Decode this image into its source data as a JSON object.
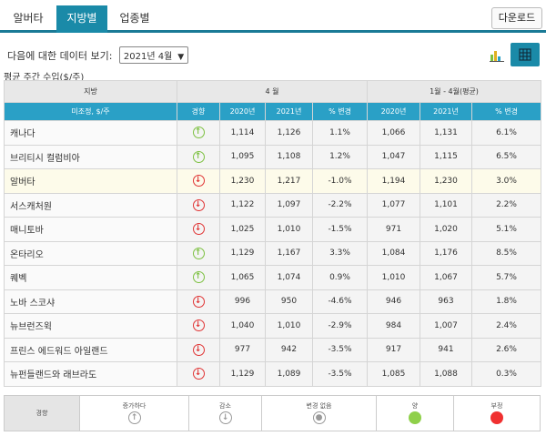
{
  "tabs": [
    {
      "label": "알버타"
    },
    {
      "label": "지방별"
    },
    {
      "label": "업종별"
    }
  ],
  "download_label": "다운로드",
  "controls": {
    "view_label": "다음에 대한 데이터 보기:",
    "selected_month": "2021년 4월"
  },
  "unit_title": "평균 주간 수입($/주)",
  "table": {
    "header_top": {
      "region": "지방",
      "group_month": "4 월",
      "group_ytd": "1월 - 4월(평균)"
    },
    "header_cols": [
      "미조정, $/주",
      "경향",
      "2020년",
      "2021년",
      "% 변경",
      "2020년",
      "2021년",
      "% 변경"
    ],
    "rows": [
      {
        "name": "캐나다",
        "trend": "up",
        "m2020": "1,114",
        "m2021": "1,126",
        "mchg": "1.1%",
        "y2020": "1,066",
        "y2021": "1,131",
        "ychg": "6.1%"
      },
      {
        "name": "브리티시 컬럼비아",
        "trend": "up",
        "m2020": "1,095",
        "m2021": "1,108",
        "mchg": "1.2%",
        "y2020": "1,047",
        "y2021": "1,115",
        "ychg": "6.5%"
      },
      {
        "name": "알버타",
        "trend": "down",
        "m2020": "1,230",
        "m2021": "1,217",
        "mchg": "-1.0%",
        "y2020": "1,194",
        "y2021": "1,230",
        "ychg": "3.0%"
      },
      {
        "name": "서스캐처원",
        "trend": "down",
        "m2020": "1,122",
        "m2021": "1,097",
        "mchg": "-2.2%",
        "y2020": "1,077",
        "y2021": "1,101",
        "ychg": "2.2%"
      },
      {
        "name": "매니토바",
        "trend": "down",
        "m2020": "1,025",
        "m2021": "1,010",
        "mchg": "-1.5%",
        "y2020": "971",
        "y2021": "1,020",
        "ychg": "5.1%"
      },
      {
        "name": "온타리오",
        "trend": "up",
        "m2020": "1,129",
        "m2021": "1,167",
        "mchg": "3.3%",
        "y2020": "1,084",
        "y2021": "1,176",
        "ychg": "8.5%"
      },
      {
        "name": "퀘벡",
        "trend": "up",
        "m2020": "1,065",
        "m2021": "1,074",
        "mchg": "0.9%",
        "y2020": "1,010",
        "y2021": "1,067",
        "ychg": "5.7%"
      },
      {
        "name": "노바 스코샤",
        "trend": "down",
        "m2020": "996",
        "m2021": "950",
        "mchg": "-4.6%",
        "y2020": "946",
        "y2021": "963",
        "ychg": "1.8%"
      },
      {
        "name": "뉴브런즈윅",
        "trend": "down",
        "m2020": "1,040",
        "m2021": "1,010",
        "mchg": "-2.9%",
        "y2020": "984",
        "y2021": "1,007",
        "ychg": "2.4%"
      },
      {
        "name": "프린스 에드워드 아일랜드",
        "trend": "down",
        "m2020": "977",
        "m2021": "942",
        "mchg": "-3.5%",
        "y2020": "917",
        "y2021": "941",
        "ychg": "2.6%"
      },
      {
        "name": "뉴펀들랜드와 래브라도",
        "trend": "down",
        "m2020": "1,129",
        "m2021": "1,089",
        "mchg": "-3.5%",
        "y2020": "1,085",
        "y2021": "1,088",
        "ychg": "0.3%"
      }
    ]
  },
  "legend": {
    "title": "경향",
    "increase": "증가하다",
    "decrease": "감소",
    "nochange": "변경 없음",
    "positive": "양",
    "negative": "부정"
  },
  "colors": {
    "accent": "#1a8aa8",
    "header_blue": "#2aa0c6",
    "up": "#7cc040",
    "down": "#e03434",
    "highlight_row": "#fdfbea"
  },
  "icons": {
    "chart": "bar-chart-icon",
    "table": "table-grid-icon"
  }
}
